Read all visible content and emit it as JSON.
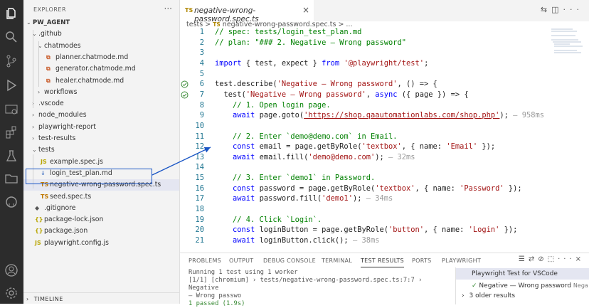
{
  "activity_bar": {
    "icons": [
      "files-icon",
      "search-icon",
      "source-control-icon",
      "run-debug-icon",
      "remote-explorer-icon",
      "extensions-icon",
      "testing-icon",
      "folder-icon",
      "github-icon",
      "account-icon",
      "settings-gear-icon"
    ]
  },
  "sidebar": {
    "header": "EXPLORER",
    "more": "···",
    "timeline": "TIMELINE",
    "tree": [
      {
        "label": "PW_AGENT",
        "depth": 0,
        "kind": "root"
      },
      {
        "label": ".github",
        "depth": 1,
        "kind": "folder-open"
      },
      {
        "label": "chatmodes",
        "depth": 2,
        "kind": "folder-open"
      },
      {
        "label": "planner.chatmode.md",
        "depth": 3,
        "kind": "chatmode"
      },
      {
        "label": "generator.chatmode.md",
        "depth": 3,
        "kind": "chatmode"
      },
      {
        "label": "healer.chatmode.md",
        "depth": 3,
        "kind": "chatmode"
      },
      {
        "label": "workflows",
        "depth": 2,
        "kind": "folder"
      },
      {
        "label": ".vscode",
        "depth": 1,
        "kind": "folder"
      },
      {
        "label": "node_modules",
        "depth": 1,
        "kind": "folder"
      },
      {
        "label": "playwright-report",
        "depth": 1,
        "kind": "folder"
      },
      {
        "label": "test-results",
        "depth": 1,
        "kind": "folder"
      },
      {
        "label": "tests",
        "depth": 1,
        "kind": "folder-open"
      },
      {
        "label": "example.spec.js",
        "depth": 2,
        "kind": "js"
      },
      {
        "label": "login_test_plan.md",
        "depth": 2,
        "kind": "md"
      },
      {
        "label": "negative-wrong-password.spec.ts",
        "depth": 2,
        "kind": "ts",
        "selected": true
      },
      {
        "label": "seed.spec.ts",
        "depth": 2,
        "kind": "ts"
      },
      {
        "label": ".gitignore",
        "depth": 1,
        "kind": "git"
      },
      {
        "label": "package-lock.json",
        "depth": 1,
        "kind": "json"
      },
      {
        "label": "package.json",
        "depth": 1,
        "kind": "json"
      },
      {
        "label": "playwright.config.js",
        "depth": 1,
        "kind": "js"
      }
    ]
  },
  "editor": {
    "tab": {
      "badge": "TS",
      "name": "negative-wrong-password.spec.ts",
      "close": "×"
    },
    "breadcrumb": {
      "folder": "tests",
      "sep": ">",
      "badge": "TS",
      "file": "negative-wrong-password.spec.ts",
      "more": "> ..."
    },
    "lines": [
      {
        "n": "1",
        "text": "// spec: tests/login_test_plan.md"
      },
      {
        "n": "2",
        "text": "// plan: \"### 2. Negative — Wrong password\""
      },
      {
        "n": "3",
        "text": ""
      },
      {
        "n": "4",
        "text": "import { test, expect } from '@playwright/test';"
      },
      {
        "n": "5",
        "text": ""
      },
      {
        "n": "6",
        "text": "test.describe('Negative — Wrong password', () => {",
        "check": true
      },
      {
        "n": "7",
        "text": "  test('Negative — Wrong password', async ({ page }) => {",
        "check": true
      },
      {
        "n": "8",
        "text": "    // 1. Open login page."
      },
      {
        "n": "9",
        "text": "    await page.goto('https://shop.qaautomationlabs.com/shop.php'); — 958ms"
      },
      {
        "n": "10",
        "text": ""
      },
      {
        "n": "11",
        "text": "    // 2. Enter `demo@demo.com` in Email."
      },
      {
        "n": "12",
        "text": "    const email = page.getByRole('textbox', { name: 'Email' });"
      },
      {
        "n": "13",
        "text": "    await email.fill('demo@demo.com'); — 32ms"
      },
      {
        "n": "14",
        "text": ""
      },
      {
        "n": "15",
        "text": "    // 3. Enter `demo1` in Password."
      },
      {
        "n": "16",
        "text": "    const password = page.getByRole('textbox', { name: 'Password' });"
      },
      {
        "n": "17",
        "text": "    await password.fill('demo1'); — 34ms"
      },
      {
        "n": "18",
        "text": ""
      },
      {
        "n": "19",
        "text": "    // 4. Click `Login`."
      },
      {
        "n": "20",
        "text": "    const loginButton = page.getByRole('button', { name: 'Login' });"
      },
      {
        "n": "21",
        "text": "    await loginButton.click(); — 38ms"
      }
    ]
  },
  "panel": {
    "tabs": [
      {
        "label": "PROBLEMS"
      },
      {
        "label": "OUTPUT"
      },
      {
        "label": "DEBUG CONSOLE"
      },
      {
        "label": "TERMINAL"
      },
      {
        "label": "TEST RESULTS",
        "active": true
      },
      {
        "label": "PORTS"
      },
      {
        "label": "PLAYWRIGHT"
      }
    ],
    "output": [
      "Running 1 test using 1 worker",
      "[1/1] [chromium] › tests/negative-wrong-password.spec.ts:7:7 › Negative",
      "— Wrong passwo",
      "  1 passed (1.9s)"
    ],
    "run_header": "Playwright Test for VSCode",
    "run_item": "Negative — Wrong password",
    "run_item_suffix": "Nega",
    "older": "3 older results"
  },
  "colors": {
    "accent": "#1a56c5",
    "pass": "#388a34",
    "string": "#a31515",
    "keyword": "#0000ff",
    "comment": "#008000"
  }
}
